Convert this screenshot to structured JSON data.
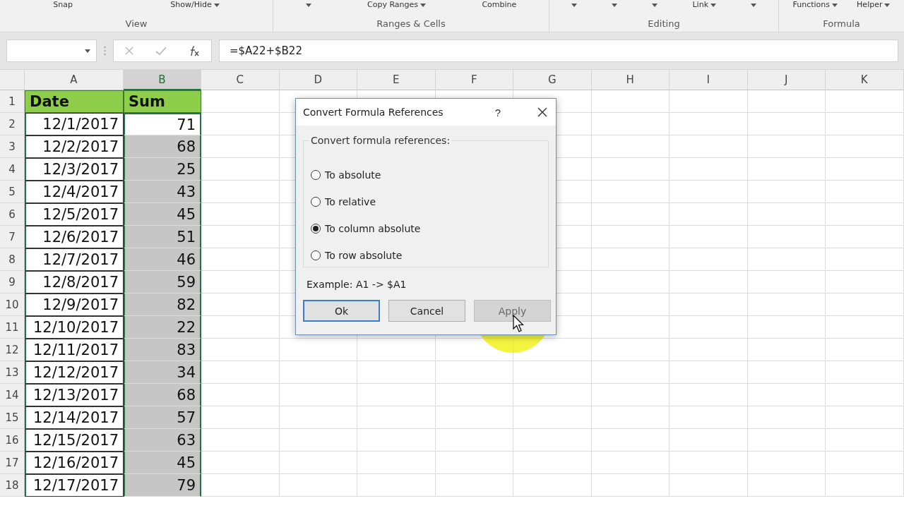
{
  "ribbon": {
    "groups": [
      {
        "label": "View",
        "items": [
          {
            "kind": "button",
            "label": "Snap"
          },
          {
            "kind": "dropdown",
            "label": "Show/Hide"
          }
        ]
      },
      {
        "label": "Ranges & Cells",
        "items": [
          {
            "kind": "caret"
          },
          {
            "kind": "dropdown",
            "label": "Copy Ranges"
          },
          {
            "kind": "button",
            "label": "Combine"
          }
        ]
      },
      {
        "label": "Editing",
        "items": [
          {
            "kind": "caret"
          },
          {
            "kind": "caret"
          },
          {
            "kind": "caret"
          },
          {
            "kind": "dropdown",
            "label": "Link"
          },
          {
            "kind": "caret"
          }
        ]
      },
      {
        "label": "Formula",
        "items": [
          {
            "kind": "dropdown",
            "label": "Functions"
          },
          {
            "kind": "dropdown",
            "label": "Helper"
          }
        ]
      }
    ]
  },
  "formula_bar": {
    "formula": "=$A22+$B22"
  },
  "sheet": {
    "columns": [
      {
        "label": "A",
        "selected": false
      },
      {
        "label": "B",
        "selected": true
      },
      {
        "label": "C",
        "selected": false
      },
      {
        "label": "D",
        "selected": false
      },
      {
        "label": "E",
        "selected": false
      },
      {
        "label": "F",
        "selected": false
      },
      {
        "label": "G",
        "selected": false
      },
      {
        "label": "H",
        "selected": false
      },
      {
        "label": "I",
        "selected": false
      },
      {
        "label": "J",
        "selected": false
      },
      {
        "label": "K",
        "selected": false
      }
    ],
    "header_row": {
      "number": "1",
      "cells": [
        "Date",
        "Sum"
      ]
    },
    "rows": [
      {
        "number": "2",
        "date": "12/1/2017",
        "sum": "71",
        "selected": true,
        "active": true
      },
      {
        "number": "3",
        "date": "12/2/2017",
        "sum": "68",
        "selected": true,
        "active": false
      },
      {
        "number": "4",
        "date": "12/3/2017",
        "sum": "25",
        "selected": true,
        "active": false
      },
      {
        "number": "5",
        "date": "12/4/2017",
        "sum": "43",
        "selected": true,
        "active": false
      },
      {
        "number": "6",
        "date": "12/5/2017",
        "sum": "45",
        "selected": true,
        "active": false
      },
      {
        "number": "7",
        "date": "12/6/2017",
        "sum": "51",
        "selected": true,
        "active": false
      },
      {
        "number": "8",
        "date": "12/7/2017",
        "sum": "46",
        "selected": true,
        "active": false
      },
      {
        "number": "9",
        "date": "12/8/2017",
        "sum": "59",
        "selected": true,
        "active": false
      },
      {
        "number": "10",
        "date": "12/9/2017",
        "sum": "82",
        "selected": true,
        "active": false
      },
      {
        "number": "11",
        "date": "12/10/2017",
        "sum": "22",
        "selected": true,
        "active": false
      },
      {
        "number": "12",
        "date": "12/11/2017",
        "sum": "83",
        "selected": true,
        "active": false
      },
      {
        "number": "13",
        "date": "12/12/2017",
        "sum": "34",
        "selected": true,
        "active": false
      },
      {
        "number": "14",
        "date": "12/13/2017",
        "sum": "68",
        "selected": true,
        "active": false
      },
      {
        "number": "15",
        "date": "12/14/2017",
        "sum": "57",
        "selected": true,
        "active": false
      },
      {
        "number": "16",
        "date": "12/15/2017",
        "sum": "63",
        "selected": true,
        "active": false
      },
      {
        "number": "17",
        "date": "12/16/2017",
        "sum": "45",
        "selected": true,
        "active": false
      },
      {
        "number": "18",
        "date": "12/17/2017",
        "sum": "79",
        "selected": true,
        "active": false
      }
    ]
  },
  "dialog": {
    "title": "Convert Formula References",
    "help": "?",
    "group_label": "Convert formula references:",
    "options": [
      {
        "label": "To absolute",
        "selected": false
      },
      {
        "label": "To relative",
        "selected": false
      },
      {
        "label": "To column absolute",
        "selected": true
      },
      {
        "label": "To row absolute",
        "selected": false
      }
    ],
    "example": "Example: A1 -> $A1",
    "buttons": [
      {
        "label": "Ok",
        "default": true,
        "disabled": false
      },
      {
        "label": "Cancel",
        "default": false,
        "disabled": false
      },
      {
        "label": "Apply",
        "default": false,
        "disabled": true
      }
    ]
  }
}
